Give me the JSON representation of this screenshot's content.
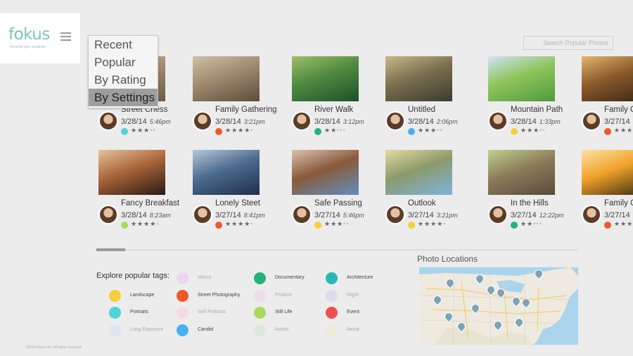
{
  "app": {
    "logo_text": "fokus",
    "tagline": "Develop your creativity",
    "copyright": "©2014 fokus inc. All rights reserved",
    "accent": "#79c7b4"
  },
  "sort_menu": {
    "items": [
      "Recent",
      "Popular",
      "By Rating",
      "By Settings"
    ],
    "selected": "By Settings"
  },
  "search": {
    "placeholder": "Search Popular Photos"
  },
  "photos": [
    {
      "title": "Street Chess",
      "date": "3/28/14",
      "time": "5:46pm",
      "color": "#4fd4d6",
      "rating": 3
    },
    {
      "title": "Family Gathering",
      "date": "3/28/14",
      "time": "3:21pm",
      "color": "#f2572a",
      "rating": 4
    },
    {
      "title": "River Walk",
      "date": "3/28/14",
      "time": "3:12pm",
      "color": "#23b37a",
      "rating": 2
    },
    {
      "title": "Untitled",
      "date": "3/28/14",
      "time": "2:06pm",
      "color": "#47b1f1",
      "rating": 3
    },
    {
      "title": "Mountain Path",
      "date": "3/28/14",
      "time": "1:33pm",
      "color": "#f6d036",
      "rating": 3
    },
    {
      "title": "Family G",
      "date": "3/27/14",
      "time": "",
      "color": "#f2572a",
      "rating": 4
    },
    {
      "title": "Fancy Breakfast",
      "date": "3/28/14",
      "time": "8:23am",
      "color": "#a8da5b",
      "rating": 4
    },
    {
      "title": "Lonely Steet",
      "date": "3/27/14",
      "time": "8:41pm",
      "color": "#f2572a",
      "rating": 4
    },
    {
      "title": "Safe Passing",
      "date": "3/27/14",
      "time": "5:46pm",
      "color": "#f6d036",
      "rating": 3
    },
    {
      "title": "Outlook",
      "date": "3/27/14",
      "time": "3:21pm",
      "color": "#f6d036",
      "rating": 4
    },
    {
      "title": "In the Hills",
      "date": "3/27/14",
      "time": "12:22pm",
      "color": "#23b37a",
      "rating": 2
    },
    {
      "title": "Family G",
      "date": "3/27/14",
      "time": "",
      "color": "#f2572a",
      "rating": 4
    }
  ],
  "tags": {
    "heading": "Explore popular tags:",
    "items": [
      {
        "label": "Landscape",
        "color": "#f6d036",
        "faded": false
      },
      {
        "label": "Portraits",
        "color": "#4fd4d6",
        "faded": false
      },
      {
        "label": "Long Exposure",
        "color": "#dfe6f1",
        "faded": true
      },
      {
        "label": "Macro",
        "color": "#ead9ee",
        "faded": true
      },
      {
        "label": "Street Photography",
        "color": "#f2572a",
        "faded": false
      },
      {
        "label": "Self Portraits",
        "color": "#f3dbe0",
        "faded": true
      },
      {
        "label": "Candid",
        "color": "#47b1f1",
        "faded": false
      },
      {
        "label": "Documentary",
        "color": "#23b37a",
        "faded": false
      },
      {
        "label": "Product",
        "color": "#f1dcea",
        "faded": true
      },
      {
        "label": "Still Life",
        "color": "#a8da5b",
        "faded": false
      },
      {
        "label": "Action",
        "color": "#dde8dd",
        "faded": true
      },
      {
        "label": "Architecture",
        "color": "#28b9b6",
        "faded": false
      },
      {
        "label": "Night",
        "color": "#e0dbeb",
        "faded": true
      },
      {
        "label": "Event",
        "color": "#f14e4e",
        "faded": false
      },
      {
        "label": "Aerial",
        "color": "#ebebd7",
        "faded": true
      }
    ]
  },
  "map": {
    "title": "Photo Locations"
  }
}
